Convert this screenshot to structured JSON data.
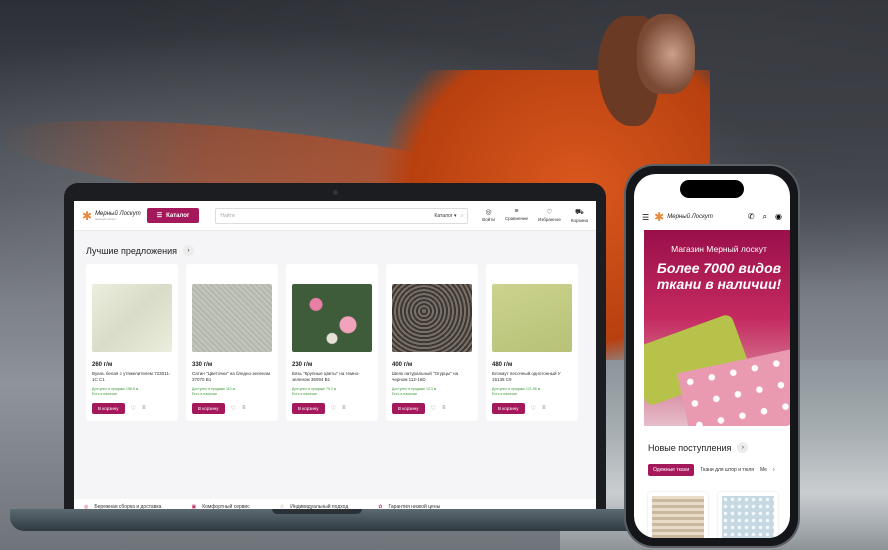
{
  "brand": {
    "name": "Мерный Лоскут",
    "tagline": "мерный лоскут"
  },
  "header": {
    "catalog_label": "Каталог",
    "search_placeholder": "Найти",
    "search_scope": "Каталог ▾",
    "icons": [
      {
        "label": "Войти",
        "icon": "user-icon"
      },
      {
        "label": "Сравнение",
        "icon": "compare-icon"
      },
      {
        "label": "Избранное",
        "icon": "heart-icon"
      },
      {
        "label": "Корзина",
        "icon": "cart-icon"
      }
    ]
  },
  "section_title": "Лучшие предложения",
  "products": [
    {
      "price": "260 г/м",
      "name": "Вуаль белая с утяжелителем 723011-1С С1",
      "avail1": "Доступно в продаже 158.6 м",
      "avail2": "Есть в наличии",
      "buy": "В корзину",
      "color": "#e4e6d6"
    },
    {
      "price": "330 г/м",
      "name": "Сатин \"Цветочки\" на бледно-зеленом 37070 В1",
      "avail1": "Доступно в продаже 110 м",
      "avail2": "Есть в наличии",
      "buy": "В корзину",
      "color": "#b8bbb3"
    },
    {
      "price": "230 г/м",
      "name": "Бязь \"Крупные цветы\" на темно-зеленом 36094 В1",
      "avail1": "Доступно в продаже 79.2 м",
      "avail2": "Есть в наличии",
      "buy": "В корзину",
      "color": "#3f5a3b"
    },
    {
      "price": "400 г/м",
      "name": "Шелк натуральный \"Огурцы\" на черном 112-16D",
      "avail1": "Доступно в продаже 12.3 м",
      "avail2": "Есть в наличии",
      "buy": "В корзину",
      "color": "#5a5550"
    },
    {
      "price": "480 г/м",
      "name": "Блэкаут песочный однотонный У 15138 С9",
      "avail1": "Доступно в продаже 121.95 м",
      "avail2": "Есть в наличии",
      "buy": "В корзину",
      "color": "#c3cc84"
    }
  ],
  "footer_features": [
    "Бережная сборка и доставка",
    "Комфортный сервис",
    "Индивидуальный подход",
    "Гарантия низкой цены"
  ],
  "phone": {
    "banner_line1": "Магазин Мерный лоскут",
    "banner_line2": "Более 7000 видов ткани в наличии!",
    "new_title": "Новые поступления",
    "tabs": [
      "Одежные ткани",
      "Ткани для штор и тюля",
      "Ме"
    ],
    "card_colors": [
      "#c9b89d",
      "#c6d8e2"
    ]
  },
  "colors": {
    "accent": "#a3195b"
  }
}
